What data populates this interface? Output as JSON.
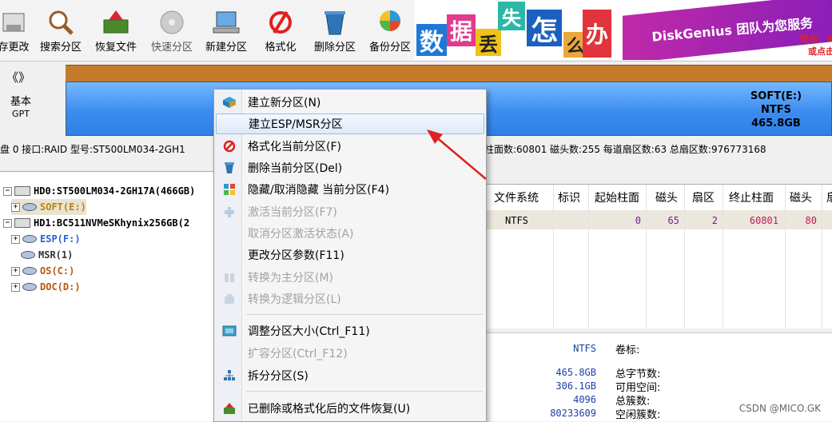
{
  "toolbar": {
    "buttons": [
      {
        "label": "存更改",
        "icon": "save-icon"
      },
      {
        "label": "搜索分区",
        "icon": "search-icon"
      },
      {
        "label": "恢复文件",
        "icon": "recover-files-icon"
      },
      {
        "label": "快速分区",
        "icon": "quick-partition-icon"
      },
      {
        "label": "新建分区",
        "icon": "new-partition-icon"
      },
      {
        "label": "格式化",
        "icon": "format-icon"
      },
      {
        "label": "删除分区",
        "icon": "delete-partition-icon"
      },
      {
        "label": "备份分区",
        "icon": "backup-partition-icon"
      }
    ]
  },
  "banner": {
    "tiles": [
      "数",
      "据",
      "丢",
      "失",
      "怎",
      "么",
      "办"
    ],
    "ribbon": "DiskGenius 团队为您服务",
    "phone": "致电：4",
    "click": "或点击"
  },
  "diskmap": {
    "nav": "《》",
    "kind": "基本",
    "style": "GPT",
    "partition": {
      "name": "SOFT(E:)",
      "fs": "NTFS",
      "size": "465.8GB"
    }
  },
  "disk_line": {
    "prefix": "盘 0 接口:RAID  型号:ST500LM034-2GH1",
    "suffix": "柱面数:60801  磁头数:255  每道扇区数:63  总扇区数:976773168"
  },
  "tree": [
    {
      "text": "HD0:ST500LM034-2GH17A(466GB)",
      "level": 0,
      "type": "disk",
      "sign": "−"
    },
    {
      "text": "SOFT(E:)",
      "level": 1,
      "type": "volume",
      "sign": "+",
      "color": "#b8860b"
    },
    {
      "text": "HD1:BC511NVMeSKhynix256GB(2",
      "level": 0,
      "type": "disk",
      "sign": "−"
    },
    {
      "text": "ESP(F:)",
      "level": 1,
      "type": "volume",
      "sign": "+",
      "color": "#2b5fd9"
    },
    {
      "text": "MSR(1)",
      "level": 1,
      "type": "volume",
      "sign": "",
      "color": "#333333"
    },
    {
      "text": "OS(C:)",
      "level": 1,
      "type": "volume",
      "sign": "+",
      "color": "#b8560b"
    },
    {
      "text": "DOC(D:)",
      "level": 1,
      "type": "volume",
      "sign": "+",
      "color": "#b8560b"
    }
  ],
  "table": {
    "headers": [
      "文件系统",
      "标识",
      "起始柱面",
      "磁头",
      "扇区",
      "终止柱面",
      "磁头",
      "扇"
    ],
    "row": [
      "NTFS",
      "",
      "0",
      "65",
      "2",
      "60801",
      "80",
      ""
    ]
  },
  "bottom": {
    "fs": "NTFS",
    "vol_label": "卷标:",
    "values": [
      "465.8GB",
      "306.1GB",
      "4096",
      "80233609"
    ],
    "labels": [
      "总字节数:",
      "可用空间:",
      "总簇数:",
      "空闲簇数:"
    ]
  },
  "menu": {
    "items": [
      {
        "label": "建立新分区(N)",
        "icon": "new-partition-icon",
        "disabled": false
      },
      {
        "label": "建立ESP/MSR分区",
        "icon": "",
        "disabled": false,
        "highlight": true
      },
      {
        "label": "格式化当前分区(F)",
        "icon": "format-icon",
        "disabled": false
      },
      {
        "label": "删除当前分区(Del)",
        "icon": "delete-icon",
        "disabled": false
      },
      {
        "label": "隐藏/取消隐藏 当前分区(F4)",
        "icon": "hide-icon",
        "disabled": false
      },
      {
        "label": "激活当前分区(F7)",
        "icon": "activate-icon",
        "disabled": true
      },
      {
        "label": "取消分区激活状态(A)",
        "icon": "",
        "disabled": true
      },
      {
        "label": "更改分区参数(F11)",
        "icon": "",
        "disabled": false
      },
      {
        "label": "转换为主分区(M)",
        "icon": "convert-primary-icon",
        "disabled": true
      },
      {
        "label": "转换为逻辑分区(L)",
        "icon": "convert-logical-icon",
        "disabled": true
      },
      {
        "label": "调整分区大小(Ctrl_F11)",
        "icon": "resize-icon",
        "disabled": false,
        "sep_before": true
      },
      {
        "label": "扩容分区(Ctrl_F12)",
        "icon": "",
        "disabled": true
      },
      {
        "label": "拆分分区(S)",
        "icon": "split-icon",
        "disabled": false
      },
      {
        "label": "已删除或格式化后的文件恢复(U)",
        "icon": "file-recovery-icon",
        "disabled": false,
        "sep_before": true
      }
    ]
  },
  "watermark": "CSDN @MICO.GK",
  "colors": {
    "accent_red": "#e02020",
    "disk_blue": "#3c8df0",
    "disk_orange": "#c57a2b"
  }
}
